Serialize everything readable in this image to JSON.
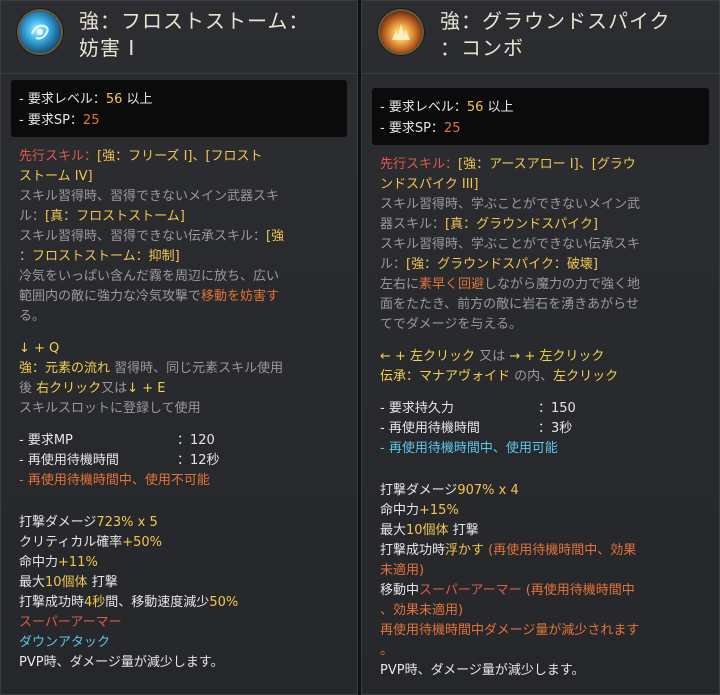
{
  "left": {
    "title_line1": "強：フロストストーム：",
    "title_line2": "妨害 I",
    "req_level_label": "- 要求レベル：",
    "req_level_value": "56",
    "req_level_suffix": " 以上",
    "req_sp_label": "- 要求SP：",
    "req_sp_value": "25",
    "prereq_label": "先行スキル：",
    "prereq_value_1": "[強：フリーズ I]、[フロスト",
    "prereq_value_2": "ストーム IV]",
    "main_weapon_1": "スキル習得時、習得できないメイン武器スキ",
    "main_weapon_2": "ル：",
    "main_weapon_skill": "[真：フロストストーム]",
    "succession_1": "スキル習得時、習得できない伝承スキル：",
    "succession_skill_a": "[強",
    "succession_skill_b": "：フロストストーム：抑制]",
    "desc_1": "冷気をいっぱい含んだ霧を周辺に放ち、広い",
    "desc_2a": "範囲内の敵に強力な冷気攻撃で",
    "desc_2b": "移動を妨害す",
    "desc_3": "る。",
    "command_1": "↓ + Q",
    "command_2a": "強：元素の流れ",
    "command_2b": " 習得時、同じ元素スキル使用",
    "command_3a": "後 ",
    "command_3b": "右クリック",
    "command_3c": "又は",
    "command_3d": "↓ + E",
    "command_4": "スキルスロットに登録して使用",
    "mp_label": "- 要求MP",
    "mp_value": "：120",
    "cd_label": "- 再使用待機時間",
    "cd_value": "：12秒",
    "cd_note": "- 再使用待機時間中、使用不可能",
    "dmg_label": "打撃ダメージ",
    "dmg_value": "723% x 5",
    "crit_label": "クリティカル確率",
    "crit_value": "+50%",
    "acc_label": "命中力",
    "acc_value": "+11%",
    "max_a": "最大",
    "max_b": "10個体",
    "max_c": " 打撃",
    "slow_a": "打撃成功時",
    "slow_b": "4秒",
    "slow_c": "間、移動速度減少",
    "slow_d": "50%",
    "super_armor": "スーパーアーマー",
    "down_attack": "ダウンアタック",
    "pvp": "PVP時、ダメージ量が減少します。"
  },
  "right": {
    "title_line1": "強：グラウンドスパイク",
    "title_line2": "：コンボ",
    "req_level_label": "- 要求レベル：",
    "req_level_value": "56",
    "req_level_suffix": " 以上",
    "req_sp_label": "- 要求SP：",
    "req_sp_value": "25",
    "prereq_label": "先行スキル：",
    "prereq_value_1": "[強：アースアロー I]、[グラウ",
    "prereq_value_2": "ンドスパイク III]",
    "main_weapon_1": "スキル習得時、学ぶことができないメイン武",
    "main_weapon_2": "器スキル：",
    "main_weapon_skill": "[真：グラウンドスパイク]",
    "succession_1": "スキル習得時、学ぶことができない伝承スキ",
    "succession_2": "ル：",
    "succession_skill": "[強：グラウンドスパイク：破壊]",
    "desc_1a": "左右に",
    "desc_1b": "素早く回避",
    "desc_1c": "しながら魔力の力で強く地",
    "desc_2": "面をたたき、前方の敵に岩石を湧きあがらせ",
    "desc_3": "てでダメージを与える。",
    "command_1a": "← + 左クリック",
    "command_1b": " 又は ",
    "command_1c": "→ + 左クリック",
    "command_2a": "伝承：マナアヴォイド",
    "command_2b": " の内、",
    "command_2c": "左クリック",
    "dur_label": "- 要求持久力",
    "dur_value": "：150",
    "cd_label": "- 再使用待機時間",
    "cd_value": "：3秒",
    "cd_note": "- 再使用待機時間中、使用可能",
    "dmg_label": "打撃ダメージ",
    "dmg_value": "907% x 4",
    "acc_label": "命中力",
    "acc_value": "+15%",
    "max_a": "最大",
    "max_b": "10個体",
    "max_c": " 打撃",
    "float_a": "打撃成功時",
    "float_b": "浮かす",
    "float_c": " (再使用待機時間中、効果",
    "float_d": "未適用)",
    "move_a": "移動中",
    "move_b": "スーパーアーマー",
    "move_c": " (再使用待機時間中",
    "move_d": "、効果未適用)",
    "cd_dmg": "再使用待機時間中ダメージ量が減少されます",
    "cd_dmg_end": "。",
    "pvp": "PVP時、ダメージ量が減少します。"
  }
}
